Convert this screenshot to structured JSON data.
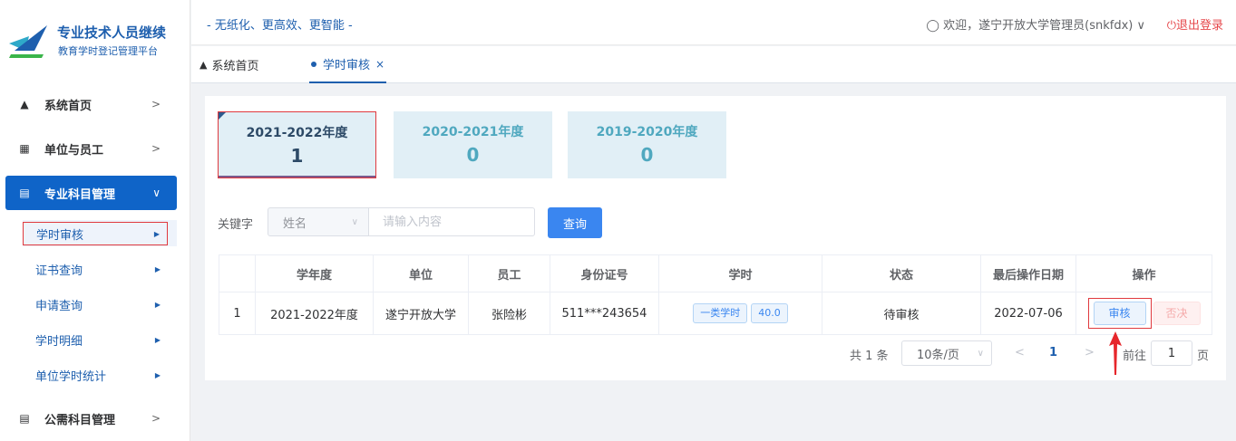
{
  "brand": {
    "line1": "专业技术人员继续",
    "line2": "教育学时登记管理平台",
    "colors": {
      "primary": "#1e5fae",
      "accent": "#3a86f0",
      "danger": "#e6474b"
    }
  },
  "header": {
    "slogan": "- 无纸化、更高效、更智能 -",
    "user": "欢迎，遂宁开放大学管理员(snkfdx)",
    "logout": "退出登录"
  },
  "sidebar": {
    "items": [
      {
        "label": "系统首页",
        "icon": "home-icon"
      },
      {
        "label": "单位与员工",
        "icon": "building-icon"
      },
      {
        "label": "专业科目管理",
        "icon": "document-icon"
      },
      {
        "label": "公需科目管理",
        "icon": "document-icon"
      }
    ],
    "subitems": [
      {
        "label": "学时审核"
      },
      {
        "label": "证书查询"
      },
      {
        "label": "申请查询"
      },
      {
        "label": "学时明细"
      },
      {
        "label": "单位学时统计"
      }
    ]
  },
  "tabs": [
    {
      "label": "系统首页"
    },
    {
      "label": "学时审核"
    }
  ],
  "years": [
    {
      "label": "2021-2022年度",
      "count": "1"
    },
    {
      "label": "2020-2021年度",
      "count": "0"
    },
    {
      "label": "2019-2020年度",
      "count": "0"
    }
  ],
  "search": {
    "label": "关键字",
    "field": "姓名",
    "placeholder": "请输入内容",
    "button": "查询"
  },
  "table": {
    "headers": [
      "",
      "学年度",
      "单位",
      "员工",
      "身份证号",
      "学时",
      "状态",
      "最后操作日期",
      "操作"
    ],
    "rows": [
      {
        "index": "1",
        "year": "2021-2022年度",
        "unit": "遂宁开放大学",
        "employee": "张险彬",
        "id_number": "511***243654",
        "hour_type": "一类学时",
        "hours": "40.0",
        "status": "待审核",
        "date": "2022-07-06",
        "audit": "审核",
        "reject": "否决"
      }
    ]
  },
  "pagination": {
    "total": "共 1 条",
    "page_size": "10条/页",
    "current": "1",
    "goto_label": "前往",
    "goto_value": "1",
    "page_suffix": "页"
  }
}
